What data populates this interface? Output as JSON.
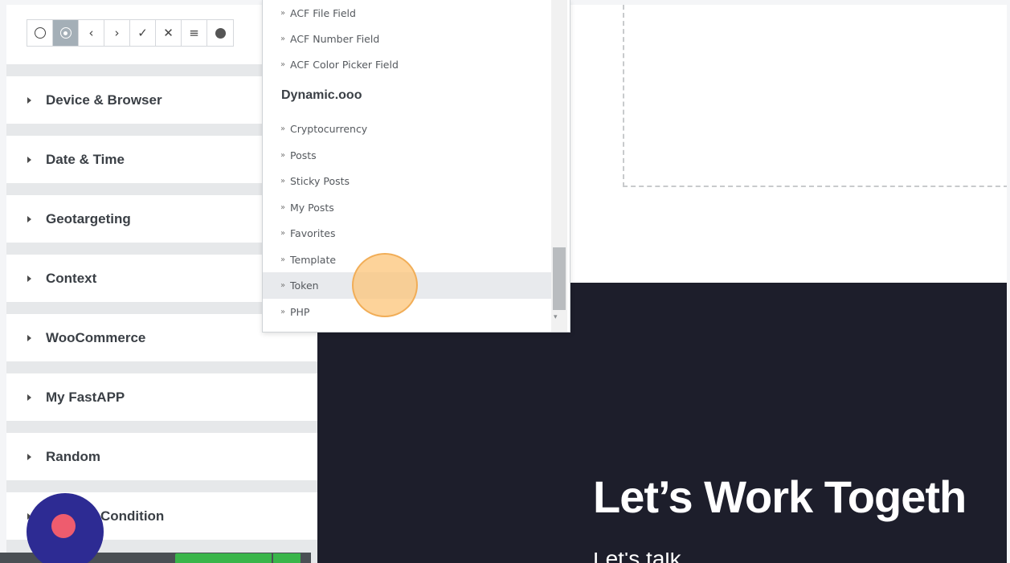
{
  "toolbar": {
    "icons": [
      "circle-outline-icon",
      "radio-dot-icon",
      "chevron-left-icon",
      "chevron-right-icon",
      "check-icon",
      "close-icon",
      "menu-lines-icon",
      "solid-dot-icon"
    ],
    "glyphs": [
      "",
      "",
      "‹",
      "›",
      "✓",
      "✕",
      "≡",
      ""
    ]
  },
  "sections": [
    {
      "label": "Device & Browser"
    },
    {
      "label": "Date & Time"
    },
    {
      "label": "Geotargeting"
    },
    {
      "label": "Context"
    },
    {
      "label": "WooCommerce"
    },
    {
      "label": "My FastAPP"
    },
    {
      "label": "Random"
    },
    {
      "label": "Condition"
    }
  ],
  "dropdown": {
    "acf_items": [
      {
        "bullet": "»",
        "label": "ACF File Field"
      },
      {
        "bullet": "»",
        "label": "ACF Number Field"
      },
      {
        "bullet": "»",
        "label": "ACF Color Picker Field"
      }
    ],
    "group_label": "Dynamic.ooo",
    "dynamic_items": [
      {
        "bullet": "»",
        "label": "Cryptocurrency"
      },
      {
        "bullet": "»",
        "label": "Posts"
      },
      {
        "bullet": "»",
        "label": "Sticky Posts"
      },
      {
        "bullet": "»",
        "label": "My Posts"
      },
      {
        "bullet": "»",
        "label": "Favorites"
      },
      {
        "bullet": "»",
        "label": "Template"
      },
      {
        "bullet": "»",
        "label": "Token"
      },
      {
        "bullet": "»",
        "label": "PHP"
      }
    ],
    "highlighted": "Token",
    "scroll_down_glyph": "▾"
  },
  "canvas": {
    "hero_title": "Let’s Work Togeth",
    "hero_sub": "Let's talk"
  },
  "colors": {
    "accent_publish": "#39b54a",
    "dark_section": "#1d1e2b",
    "fab": "#2d2b93",
    "fab_dot": "#ee5c6e",
    "click_indicator": "#fcc478"
  }
}
